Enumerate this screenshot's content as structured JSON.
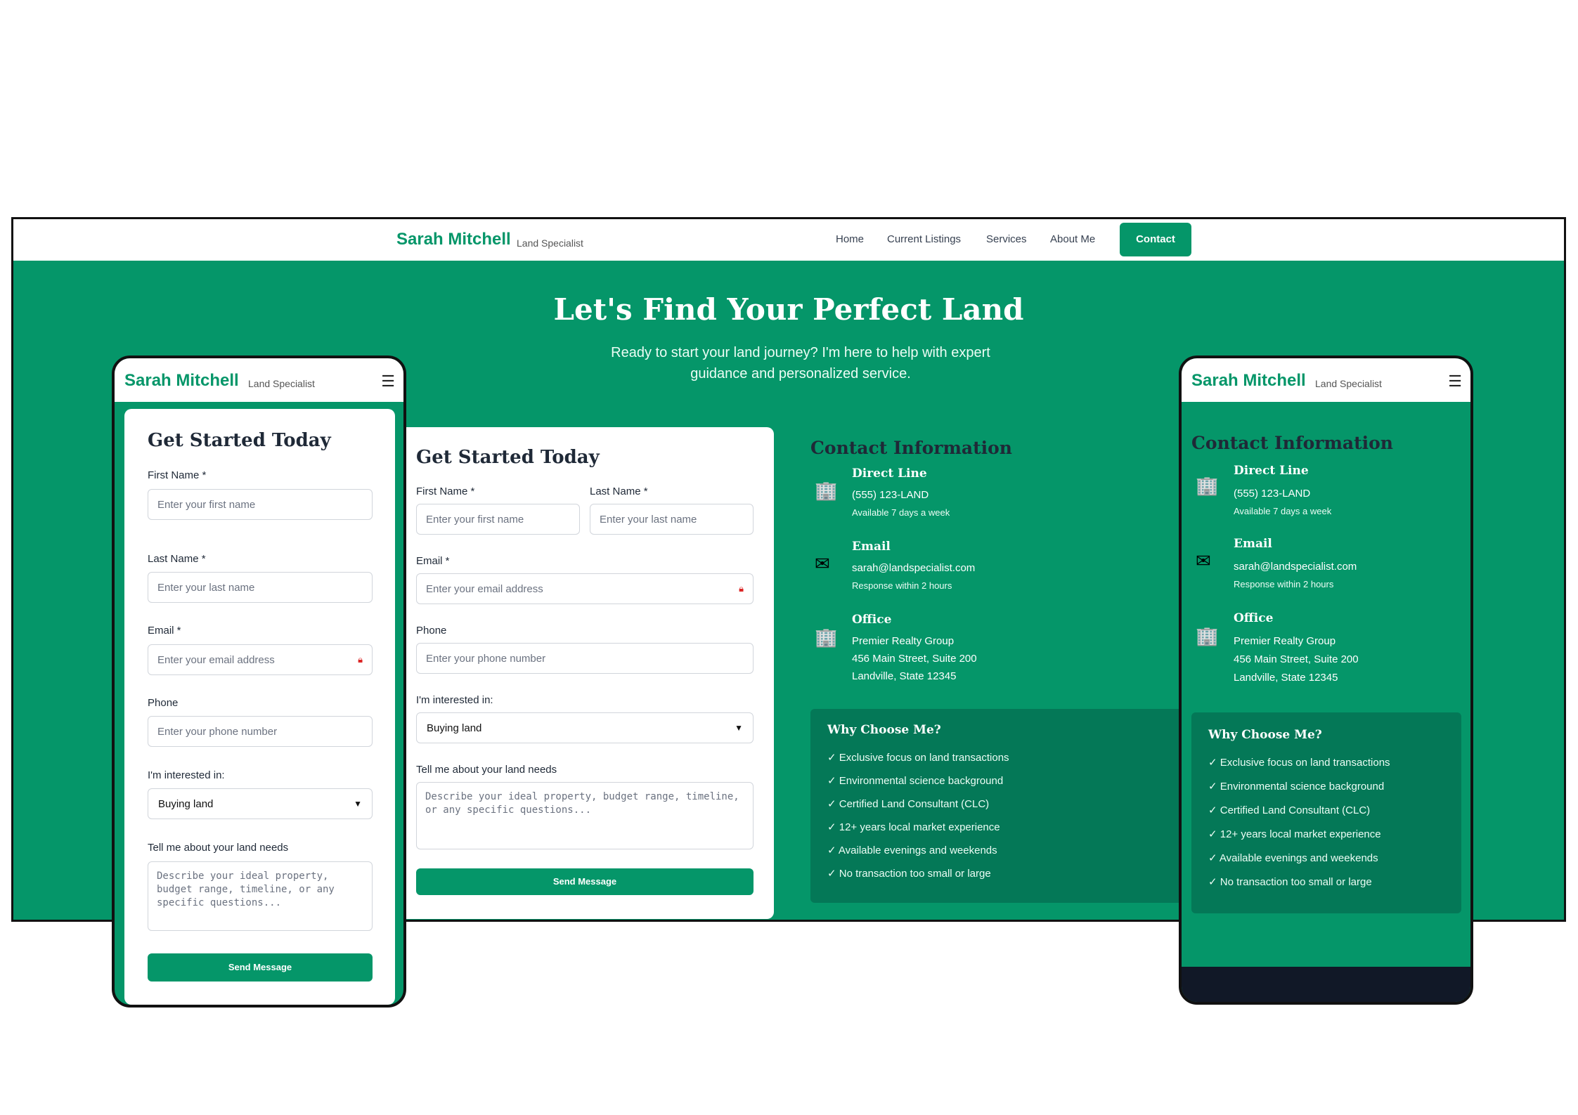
{
  "brand": {
    "name": "Sarah Mitchell",
    "tagline": "Land Specialist"
  },
  "nav": {
    "items": [
      "Home",
      "Current Listings",
      "Services",
      "About Me"
    ],
    "cta": "Contact"
  },
  "hero": {
    "title": "Let's Find Your Perfect Land",
    "subtitle": "Ready to start your land journey? I'm here to help with expert guidance and personalized service."
  },
  "form": {
    "title": "Get Started Today",
    "first_name_label": "First Name *",
    "first_name_placeholder": "Enter your first name",
    "last_name_label": "Last Name *",
    "last_name_placeholder": "Enter your last name",
    "email_label": "Email *",
    "email_placeholder": "Enter your email address",
    "phone_label": "Phone",
    "phone_placeholder": "Enter your phone number",
    "interest_label": "I'm interested in:",
    "interest_value": "Buying land",
    "needs_label": "Tell me about your land needs",
    "needs_placeholder": "Describe your ideal property, budget range, timeline, or any specific questions...",
    "submit": "Send Message"
  },
  "contact": {
    "title": "Contact Information",
    "phone": {
      "title": "Direct Line",
      "value": "(555) 123-LAND",
      "note": "Available 7 days a week"
    },
    "email": {
      "title": "Email",
      "value": "sarah@landspecialist.com",
      "note": "Response within 2 hours"
    },
    "office": {
      "title": "Office",
      "line1": "Premier Realty Group",
      "line2": "456 Main Street, Suite 200",
      "line3": "Landville, State 12345"
    }
  },
  "why": {
    "title": "Why Choose Me?",
    "items": [
      "✓ Exclusive focus on land transactions",
      "✓ Environmental science background",
      "✓ Certified Land Consultant (CLC)",
      "✓ 12+ years local market experience",
      "✓ Available evenings and weekends",
      "✓ No transaction too small or large"
    ]
  },
  "icons": {
    "phone": "office-building-phone-icon",
    "email": "envelope-icon",
    "office": "office-building-icon",
    "lock": "password-lock-icon",
    "menu": "hamburger-menu-icon",
    "chevron": "chevron-down-icon"
  },
  "colors": {
    "primary": "#059669",
    "dark": "#047857",
    "text": "#1f2937"
  }
}
